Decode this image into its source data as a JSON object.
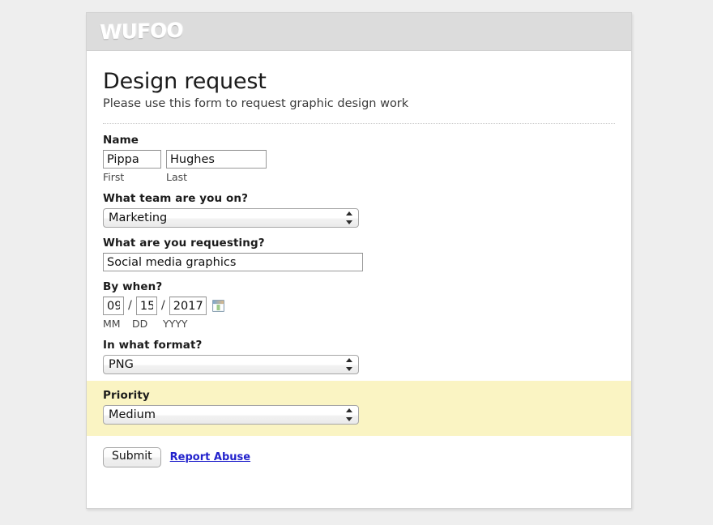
{
  "brand": {
    "logo_text": "WUFOO"
  },
  "header": {
    "title": "Design request",
    "subtitle": "Please use this form to request graphic design work"
  },
  "fields": {
    "name": {
      "label": "Name",
      "first_value": "Pippa",
      "first_sublabel": "First",
      "last_value": "Hughes",
      "last_sublabel": "Last"
    },
    "team": {
      "label": "What team are you on?",
      "value": "Marketing"
    },
    "request": {
      "label": "What are you requesting?",
      "value": "Social media graphics"
    },
    "by_when": {
      "label": "By when?",
      "month_value": "09",
      "day_value": "15",
      "year_value": "2017",
      "separator": "/",
      "month_sublabel": "MM",
      "day_sublabel": "DD",
      "year_sublabel": "YYYY",
      "calendar_icon": "calendar-icon"
    },
    "format": {
      "label": "In what format?",
      "value": "PNG"
    },
    "priority": {
      "label": "Priority",
      "value": "Medium",
      "highlight_color": "#faf4c3"
    }
  },
  "actions": {
    "submit_label": "Submit",
    "report_abuse_label": "Report Abuse",
    "link_color": "#2222cc"
  }
}
